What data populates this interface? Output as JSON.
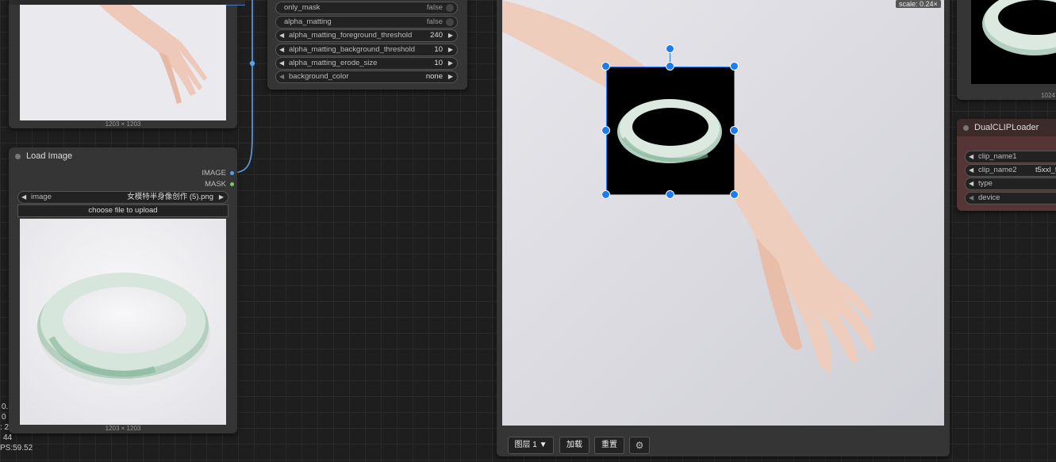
{
  "preview_node": {
    "caption": "1203 × 1203"
  },
  "load_image_node": {
    "title": "Load Image",
    "outputs": [
      "IMAGE",
      "MASK"
    ],
    "image_widget": {
      "label": "image",
      "value": "女模特半身像创作 (5).png"
    },
    "upload_label": "choose file to upload",
    "caption": "1203 × 1203"
  },
  "rembg_node": {
    "widgets": [
      {
        "label": "only_mask",
        "value": "false",
        "kind": "toggle"
      },
      {
        "label": "alpha_matting",
        "value": "false",
        "kind": "toggle"
      },
      {
        "label": "alpha_matting_foreground_threshold",
        "value": "240",
        "kind": "number"
      },
      {
        "label": "alpha_matting_background_threshold",
        "value": "10",
        "kind": "number"
      },
      {
        "label": "alpha_matting_erode_size",
        "value": "10",
        "kind": "number"
      },
      {
        "label": "background_color",
        "value": "none",
        "kind": "combo"
      }
    ]
  },
  "canvas_node": {
    "scale_badge": "scale: 0.24×",
    "toolbar": {
      "layer": "图层 1 ▼",
      "load": "加载",
      "reset": "重置",
      "settings_icon": "gear-icon"
    }
  },
  "right_preview": {
    "caption": "1024"
  },
  "dual_clip_node": {
    "title": "DualCLIPLoader",
    "widgets": [
      {
        "label": "clip_name1",
        "value": ""
      },
      {
        "label": "clip_name2",
        "value": "t5xxl_f"
      },
      {
        "label": "type",
        "value": ""
      },
      {
        "label": "device",
        "value": ""
      }
    ]
  },
  "stats": [
    "0.",
    "0",
    ": 2",
    "44",
    "PS:59.52"
  ]
}
